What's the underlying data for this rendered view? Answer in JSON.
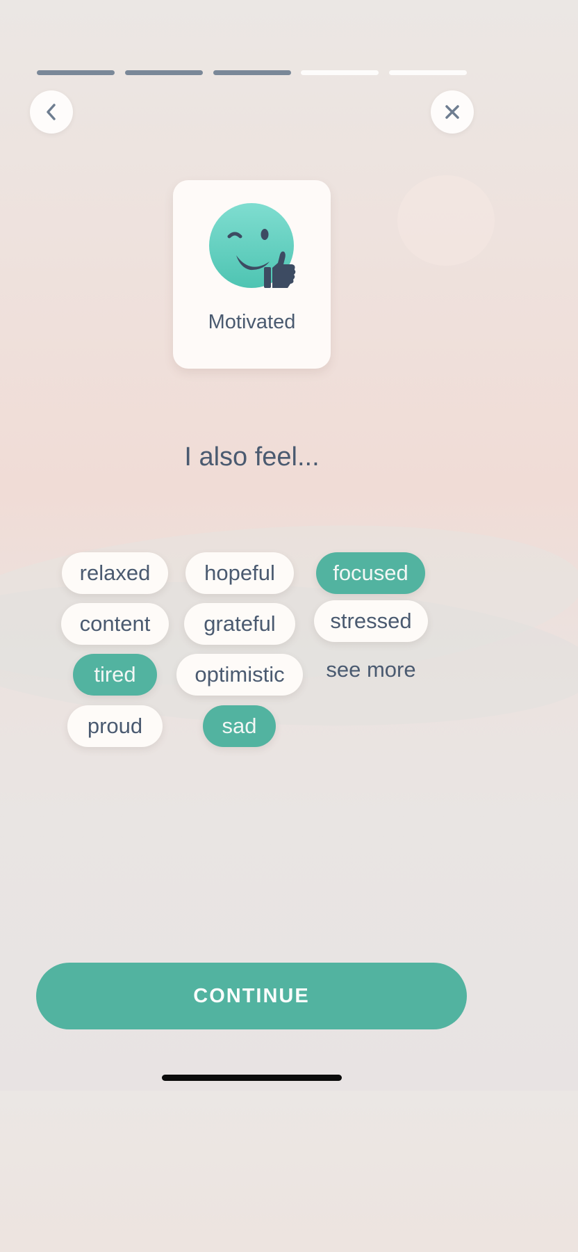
{
  "progress": {
    "total_steps": 5,
    "completed_steps": 3
  },
  "nav": {
    "back_icon": "chevron-left-icon",
    "close_icon": "close-icon"
  },
  "mood": {
    "label": "Motivated",
    "icon": "winking-thumbs-up-face-icon"
  },
  "heading": "I also feel...",
  "feelings": [
    {
      "label": "relaxed",
      "selected": false
    },
    {
      "label": "hopeful",
      "selected": false
    },
    {
      "label": "focused",
      "selected": true
    },
    {
      "label": "content",
      "selected": false
    },
    {
      "label": "grateful",
      "selected": false
    },
    {
      "label": "stressed",
      "selected": false
    },
    {
      "label": "tired",
      "selected": true
    },
    {
      "label": "optimistic",
      "selected": false
    },
    {
      "label": "proud",
      "selected": false
    },
    {
      "label": "sad",
      "selected": true
    }
  ],
  "see_more_label": "see more",
  "continue_label": "CONTINUE",
  "colors": {
    "accent": "#52b3a0",
    "text": "#4a5a70",
    "progress_done": "#7a8898",
    "progress_todo": "#fdfcfb"
  }
}
